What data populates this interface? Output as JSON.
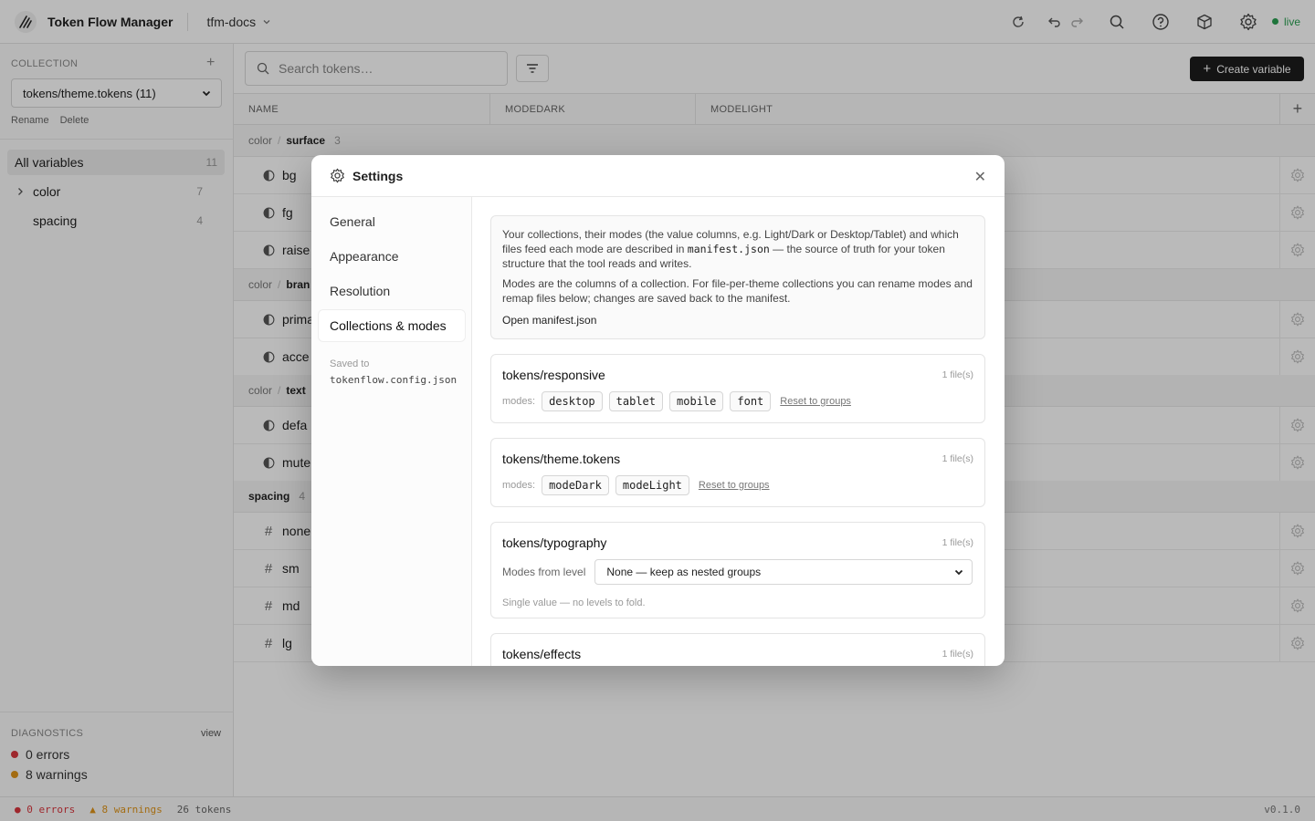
{
  "app": {
    "title": "Token Flow Manager",
    "workspace": "tfm-docs",
    "status": "live",
    "version": "v0.1.0"
  },
  "colors": {
    "accent": "#1c1c1c",
    "live": "#2aa052",
    "error": "#d9363e",
    "warning": "#e0951a"
  },
  "sidebar": {
    "collection_label": "COLLECTION",
    "collection_value": "tokens/theme.tokens (11)",
    "rename": "Rename",
    "delete": "Delete",
    "items": [
      {
        "label": "All variables",
        "count": "11"
      },
      {
        "label": "color",
        "count": "7"
      },
      {
        "label": "spacing",
        "count": "4"
      }
    ],
    "diagnostics_label": "DIAGNOSTICS",
    "diagnostics_view": "view",
    "errors": "0 errors",
    "warnings": "8 warnings"
  },
  "main": {
    "search_placeholder": "Search tokens…",
    "create_label": "Create variable",
    "columns": [
      "NAME",
      "MODEDARK",
      "MODELIGHT"
    ],
    "groups": [
      {
        "prefix": "color",
        "name": "surface",
        "count": "3"
      },
      {
        "prefix": "color",
        "name": "bran"
      },
      {
        "prefix": "color",
        "name": "text"
      },
      {
        "name": "spacing",
        "count": "4"
      }
    ],
    "rows": [
      "bg",
      "fg",
      "raise",
      "prima",
      "acce",
      "defa",
      "mute",
      "none",
      "sm",
      "md",
      "lg"
    ]
  },
  "statusbar": {
    "errors": "0 errors",
    "warnings": "▲ 8 warnings",
    "tokens": "26 tokens"
  },
  "modal": {
    "title": "Settings",
    "nav": [
      "General",
      "Appearance",
      "Resolution",
      "Collections & modes"
    ],
    "saved_label": "Saved to",
    "saved_file": "tokenflow.config.json",
    "info": {
      "p1_a": "Your collections, their modes (the value columns, e.g. Light/Dark or Desktop/Tablet) and which files feed each mode are described in ",
      "p1_code": "manifest.json",
      "p1_b": " — the source of truth for your token structure that the tool reads and writes.",
      "p2": "Modes are the columns of a collection. For file-per-theme collections you can rename modes and remap files below; changes are saved back to the manifest.",
      "open": "Open manifest.json"
    },
    "modes_label": "modes:",
    "reset_label": "Reset to groups",
    "cards": [
      {
        "title": "tokens/responsive",
        "files": "1 file(s)",
        "modes": [
          "desktop",
          "tablet",
          "mobile",
          "font"
        ]
      },
      {
        "title": "tokens/theme.tokens",
        "files": "1 file(s)",
        "modes": [
          "modeDark",
          "modeLight"
        ]
      },
      {
        "title": "tokens/typography",
        "files": "1 file(s)",
        "level_label": "Modes from level",
        "level_value": "None — keep as nested groups",
        "hint": "Single value — no levels to fold."
      },
      {
        "title": "tokens/effects",
        "files": "1 file(s)"
      }
    ]
  }
}
